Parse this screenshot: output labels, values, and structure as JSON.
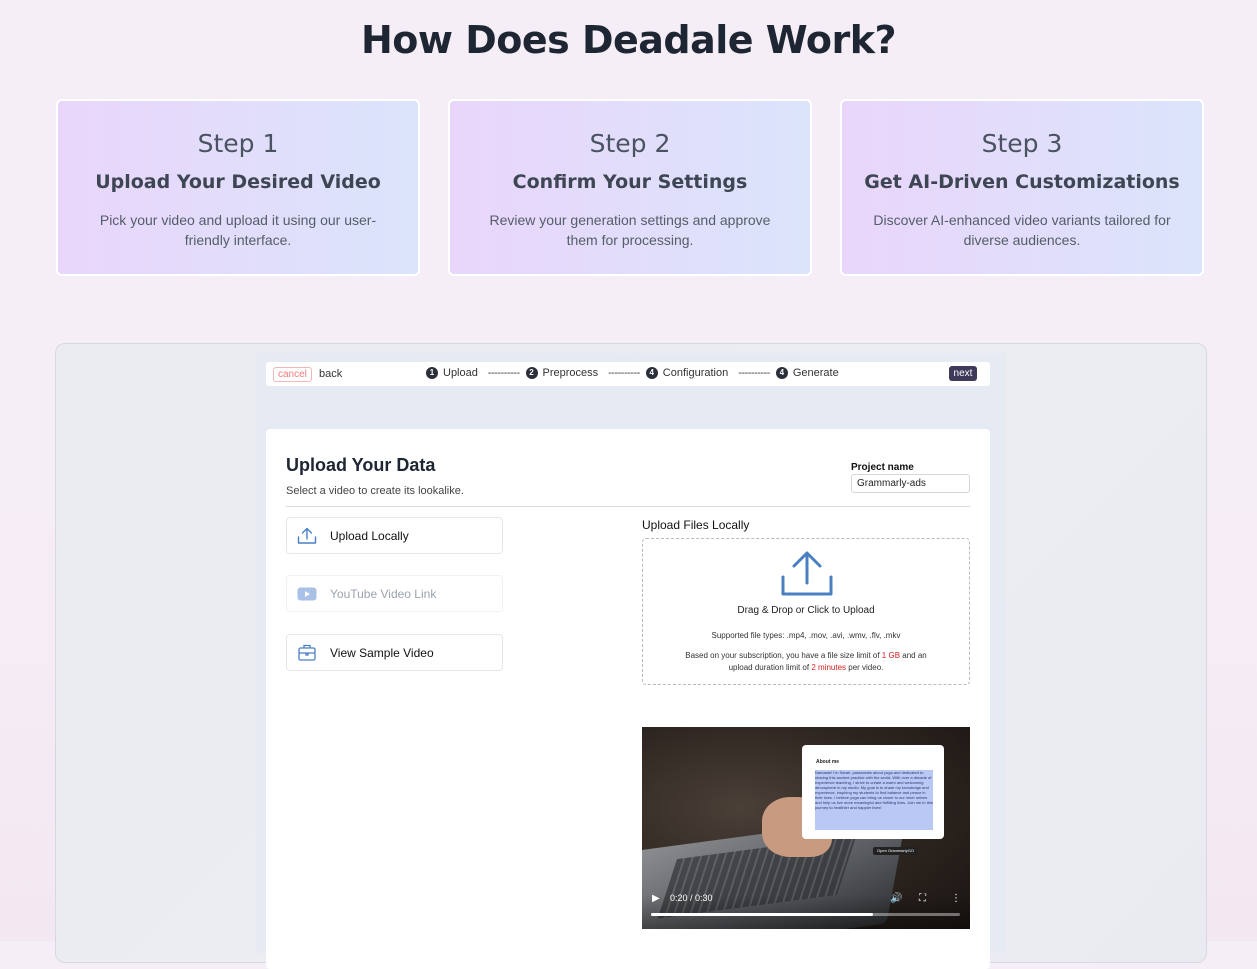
{
  "page": {
    "title": "How Does Deadale Work?"
  },
  "steps": [
    {
      "number": "Step 1",
      "title": "Upload Your Desired Video",
      "description": "Pick your video and upload it using our user-friendly interface."
    },
    {
      "number": "Step 2",
      "title": "Confirm Your Settings",
      "description": "Review your generation settings and approve them for processing."
    },
    {
      "number": "Step 3",
      "title": "Get AI-Driven Customizations",
      "description": "Discover AI-enhanced video variants tailored for diverse audiences."
    }
  ],
  "app": {
    "topbar": {
      "cancel": "cancel",
      "back": "back",
      "next": "next",
      "stepper": [
        {
          "num": "1",
          "label": "Upload"
        },
        {
          "num": "2",
          "label": "Preprocess"
        },
        {
          "num": "4",
          "label": "Configuration"
        },
        {
          "num": "4",
          "label": "Generate"
        }
      ],
      "separator": "----------"
    },
    "upload": {
      "title": "Upload Your Data",
      "subtitle": "Select a video to create its lookalike.",
      "project_label": "Project name",
      "project_value": "Grammarly-ads",
      "options": [
        {
          "label": "Upload Locally",
          "icon": "upload-icon",
          "enabled": true
        },
        {
          "label": "YouTube Video Link",
          "icon": "youtube-icon",
          "enabled": false
        },
        {
          "label": "View Sample Video",
          "icon": "briefcase-icon",
          "enabled": true
        }
      ],
      "files_heading": "Upload Files Locally",
      "dropzone": {
        "text": "Drag & Drop or Click to Upload",
        "types": "Supported file types: .mp4, .mov, .avi, .wmv, .flv, .mkv",
        "limit_pre": "Based on your subscription, you have a file size limit of ",
        "limit_size": "1 GB",
        "limit_mid": " and an upload duration limit of ",
        "limit_duration": "2 minutes",
        "limit_post": " per video."
      }
    },
    "video": {
      "time": "0:20 / 0:30",
      "progress": 0.72,
      "overlay_title": "About me",
      "overlay_text": "Namaste! I'm Sarah, passionate about yoga and dedicated to sharing this ancient practice with the world. With over a decade of experience teaching, I strive to create a warm and welcoming atmosphere in my studio. My goal is to share my knowledge and experience, inspiring my students to find balance and peace in their lives. I believe yoga can bring us closer to our inner selves and help us live more meaningful and fulfilling lives. Join me in this journey to healthier and happier lives!",
      "overlay_button": "Open GrammarlyGO"
    },
    "colors": {
      "accent": "#3f3a5a",
      "limit_highlight": "#d21f1f",
      "icon_blue": "#4a7fc1"
    }
  }
}
